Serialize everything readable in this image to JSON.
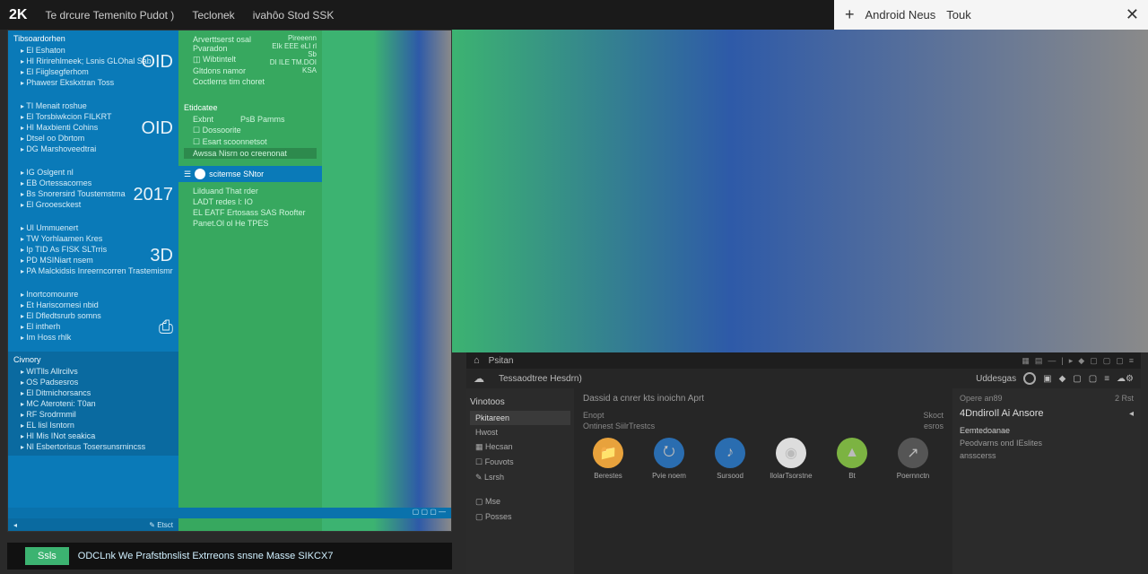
{
  "topbar": {
    "logo": "2K",
    "items": [
      "Te drcure Temenito Pudot  )",
      "Teclonek",
      "ivahôo Stod SSK"
    ]
  },
  "right_header": {
    "plus": "+",
    "title": "Android Neus",
    "sub": "Touk",
    "close": "✕"
  },
  "ide_left": {
    "group1": {
      "hdr": "Tibsoardorhen",
      "items": [
        "El Eshaton",
        "Hl Ririrehlmeek; Lsnis GLOhal Sab",
        "El Fiiglsegferhom",
        "Phawesr Ekskxtran Toss"
      ],
      "badge": "OID"
    },
    "group2": {
      "items": [
        "TI Menait roshue",
        "El Torsbiwkcion FILKRT",
        "Hl Maxbienti Cohins",
        "Dtsel oo Dbrtom",
        "DG Marshoveedtrai"
      ],
      "badge": "OID"
    },
    "group3": {
      "items": [
        "IG Oslgent nl",
        "EB Ortessacornes",
        "Bs Snorersird Toustemstma",
        "El Grooesckest"
      ],
      "badge": "2017"
    },
    "group4": {
      "items": [
        "Ul Ummuenert",
        "TW Yorhlaamen Kres",
        "Ip TID As FISK SLTrris",
        "PD MSINiart nsem",
        "PA Malckidsis Inreerncorren Trastemismra"
      ],
      "badge": "3D"
    },
    "group5": {
      "items": [
        "Inortcomounre",
        "Et Hariscornesi nbid",
        "El Dfledtsrurb somns",
        "El intherh",
        "Im Hoss rhlk"
      ],
      "badge": "⎙"
    },
    "group6": {
      "hdr": "Civnory",
      "items": [
        "WITlls Allrcilvs",
        "OS Padsesros",
        "El Ditmichorsancs",
        "MC Ateroteni: T0an",
        "RF Srodrmmil",
        "EL lisl Isntorn",
        "Hl Mis INot seakica",
        "Nl Esbertorisus Tosersunsrnincss"
      ]
    },
    "footer_left": "◂",
    "footer_right": "✎ Etsct"
  },
  "ide_right": {
    "head": {
      "items": [
        "Arverttserst osal Pvaradon",
        "◫ Wibtintelt",
        "Gltdons namor",
        "Coctlerns tim choret"
      ],
      "right": [
        "Pireeenn",
        "EIk EEE eLI rl Sb",
        "DI ILE  TM.DOI KSA"
      ]
    },
    "sec1": {
      "hdr": "Etidcatee",
      "items": [
        "Exbnt",
        "PsB Pamms",
        "☐ Dossoorite",
        "☐ Esart scoonnetsot"
      ],
      "sel": "Awssa Nisrn oo creenonat"
    },
    "sec2": {
      "hdr_icon": "◉",
      "hdr": "scitemse SNtor",
      "items": [
        "Lilduand That rder",
        "LADT redes l: IO",
        "EL EATF Ertosass SAS Roofter",
        "Panet.Ol ol He TPES"
      ]
    }
  },
  "ide_status_right": "▢ ▢ ▢  —",
  "terminal": {
    "btn": "Ssls",
    "text": "ODCLnk We Prafstbnslist Extrreons snsne Masse SIKCX7"
  },
  "studio": {
    "top": {
      "home": "⌂",
      "title": "Psitan",
      "icons": [
        "▦",
        "▤",
        "—",
        "|",
        "▸",
        "◆",
        "▢",
        "▢",
        "▢",
        "≡"
      ]
    },
    "row2": {
      "cloud": "☁",
      "path": "Tessaodtree Hesdrn)",
      "search": "Uddesgas",
      "mini": [
        "▣",
        "◆",
        "▢",
        "▢",
        "≡",
        "☁⚙"
      ]
    },
    "breadcrumb": "Dassid a cnrer kts inoichn    Aprt",
    "nav": {
      "hdr": "Vinotoos",
      "items": [
        {
          "label": "Pkitareen",
          "sel": true
        },
        {
          "label": "Hwost",
          "sel": false
        },
        {
          "label": "▦ Hecsan",
          "sel": false
        },
        {
          "label": "☐ Fouvots",
          "sel": false
        },
        {
          "label": "✎ Lsrsh",
          "sel": false
        },
        {
          "label": "▢ Mse",
          "sel": false
        },
        {
          "label": "▢ Posses",
          "sel": false
        }
      ]
    },
    "main": {
      "head_l": "Enopt",
      "head_r": "Skoct",
      "sub_l": "Ontinest SiilrTrestcs",
      "sub_r": "esros",
      "apps": [
        {
          "label": "Berestes",
          "color": "#e8a23c",
          "glyph": "📁"
        },
        {
          "label": "Pvie noem",
          "color": "#2a6db0",
          "glyph": "⭮"
        },
        {
          "label": "Sursood",
          "color": "#2a6db0",
          "glyph": "♪"
        },
        {
          "label": "llolarTsorstne",
          "color": "#ddd",
          "glyph": "◉"
        },
        {
          "label": "Bt",
          "color": "#7cb342",
          "glyph": "▲"
        },
        {
          "label": "Poernnctn",
          "color": "#555",
          "glyph": "↗"
        }
      ]
    },
    "side": {
      "head_l": "Opere an89",
      "head_r": "2 Rst",
      "title": "4DndiroIl Ai Ansore",
      "arrow": "◂",
      "sec": "Eemtedoanae",
      "items": [
        "Peodvarns ond IEslites",
        "ansscerss"
      ]
    }
  }
}
